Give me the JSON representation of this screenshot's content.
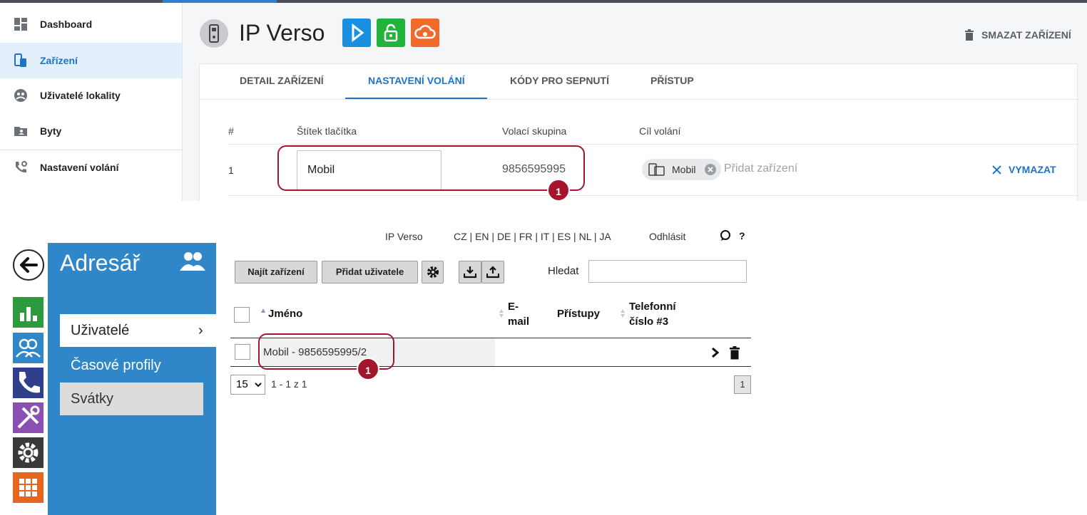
{
  "top": {
    "nav": [
      {
        "label": "Dashboard"
      },
      {
        "label": "Zařízení"
      },
      {
        "label": "Uživatelé lokality"
      },
      {
        "label": "Byty"
      },
      {
        "label": "Nastavení volání"
      }
    ],
    "device_title": "IP Verso",
    "delete_device_label": "SMAZAT ZAŘÍZENÍ",
    "tabs": [
      "DETAIL ZAŘÍZENÍ",
      "NASTAVENÍ VOLÁNÍ",
      "KÓDY PRO SEPNUTÍ",
      "PŘÍSTUP"
    ],
    "table": {
      "headers": [
        "#",
        "Štítek tlačítka",
        "Volací skupina",
        "Cíl volání"
      ],
      "row": {
        "index": "1",
        "button_label": "Mobil",
        "call_group": "9856595995",
        "target_chip": "Mobil",
        "add_device_placeholder": "Přidat zařízení",
        "delete_label": "VYMAZAT"
      }
    },
    "badge": "1",
    "colors": {
      "accent": "#1e73c8",
      "highlight": "#a4142b",
      "svc1": "#1a8fe0",
      "svc2": "#22b33a",
      "svc3": "#f06a2c"
    }
  },
  "bottom": {
    "toplinks": {
      "device": "IP Verso",
      "languages": "CZ | EN | DE | FR | IT | ES | NL | JA",
      "logout": "Odhlásit",
      "help": "?"
    },
    "title": "Adresář",
    "menu": [
      {
        "label": "Uživatelé",
        "arrow": "›"
      },
      {
        "label": "Časové profily"
      },
      {
        "label": "Svátky"
      }
    ],
    "buttons": {
      "find": "Najít zařízení",
      "add_user": "Přidat uživatele"
    },
    "search_label": "Hledat",
    "columns": {
      "name": "Jméno",
      "email": "E-\nmail",
      "access": "Přístupy",
      "phone": "Telefonní\nčíslo #3"
    },
    "row_name": "Mobil - 9856595995/2",
    "pager": {
      "per_page": "15",
      "range": "1 - 1 z 1",
      "page": "1"
    },
    "badge": "1",
    "colors": {
      "panel": "#2f86c9",
      "mod_stats": "#2e9a3e",
      "mod_users": "#2f86c9",
      "mod_phone": "#2f3f8c",
      "mod_tools": "#8a4fb0",
      "mod_settings": "#3a3a3a",
      "mod_apps": "#e4661f"
    }
  }
}
